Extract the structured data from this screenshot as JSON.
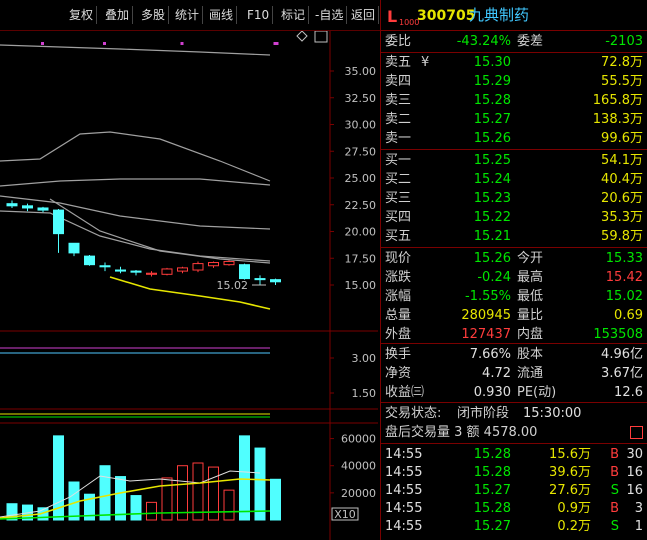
{
  "toolbar": {
    "items": [
      "复权",
      "叠加",
      "多股",
      "统计",
      "画线",
      "F10",
      "标记",
      "-自选",
      "返回"
    ]
  },
  "stock": {
    "badge": "L",
    "level": "1000",
    "code": "300705",
    "name": "九典制药"
  },
  "weibi": {
    "label1": "委比",
    "value1": "-43.24%",
    "label2": "委差",
    "value2": "-2103"
  },
  "sell": [
    {
      "label": "卖五",
      "mark": "¥",
      "price": "15.30",
      "vol": "72.8万"
    },
    {
      "label": "卖四",
      "mark": "",
      "price": "15.29",
      "vol": "55.5万"
    },
    {
      "label": "卖三",
      "mark": "",
      "price": "15.28",
      "vol": "165.8万"
    },
    {
      "label": "卖二",
      "mark": "",
      "price": "15.27",
      "vol": "138.3万"
    },
    {
      "label": "卖一",
      "mark": "",
      "price": "15.26",
      "vol": "99.6万"
    }
  ],
  "buy": [
    {
      "label": "买一",
      "price": "15.25",
      "vol": "54.1万"
    },
    {
      "label": "买二",
      "price": "15.24",
      "vol": "40.4万"
    },
    {
      "label": "买三",
      "price": "15.23",
      "vol": "20.6万"
    },
    {
      "label": "买四",
      "price": "15.22",
      "vol": "35.3万"
    },
    {
      "label": "买五",
      "price": "15.21",
      "vol": "59.8万"
    }
  ],
  "quote": [
    {
      "l1": "现价",
      "v1": "15.26",
      "l2": "今开",
      "v2": "15.33"
    },
    {
      "l1": "涨跌",
      "v1": "-0.24",
      "l2": "最高",
      "v2": "15.42"
    },
    {
      "l1": "涨幅",
      "v1": "-1.55%",
      "l2": "最低",
      "v2": "15.02"
    },
    {
      "l1": "总量",
      "v1": "280945",
      "l2": "量比",
      "v2": "0.69"
    },
    {
      "l1": "外盘",
      "v1": "127437",
      "l2": "内盘",
      "v2": "153508"
    }
  ],
  "stats": [
    {
      "l1": "换手",
      "v1": "7.66%",
      "l2": "股本",
      "v2": "4.96亿"
    },
    {
      "l1": "净资",
      "v1": "4.72",
      "l2": "流通",
      "v2": "3.67亿"
    },
    {
      "l1": "收益㈢",
      "v1": "0.930",
      "l2": "PE(动)",
      "v2": "12.6"
    }
  ],
  "trade_status": {
    "label": "交易状态:",
    "status": "闭市阶段",
    "time": "15:30:00"
  },
  "after_hours": {
    "text": "盘后交易量 3 额 4578.00"
  },
  "ticks": [
    {
      "time": "14:55",
      "price": "15.28",
      "vol": "15.6万",
      "side": "B",
      "n": "30"
    },
    {
      "time": "14:55",
      "price": "15.28",
      "vol": "39.6万",
      "side": "B",
      "n": "16"
    },
    {
      "time": "14:55",
      "price": "15.27",
      "vol": "27.6万",
      "side": "S",
      "n": "16"
    },
    {
      "time": "14:55",
      "price": "15.28",
      "vol": "0.9万",
      "side": "B",
      "n": "3"
    },
    {
      "time": "14:55",
      "price": "15.27",
      "vol": "0.2万",
      "side": "S",
      "n": "1"
    }
  ],
  "price_axis": [
    "35.00",
    "32.50",
    "30.00",
    "27.50",
    "25.00",
    "22.50",
    "20.00",
    "17.50",
    "15.00"
  ],
  "macd_axis": [
    "3.00",
    "1.50"
  ],
  "vol_axis": [
    "60000",
    "40000",
    "20000"
  ],
  "vol_unit": "X10",
  "low_label": "15.02",
  "candles": [
    {
      "o": 22.6,
      "c": 22.4,
      "h": 22.9,
      "l": 22.2
    },
    {
      "o": 22.4,
      "c": 22.2,
      "h": 22.6,
      "l": 21.9
    },
    {
      "o": 22.2,
      "c": 22.0,
      "h": 22.3,
      "l": 21.8
    },
    {
      "o": 22.0,
      "c": 19.8,
      "h": 22.1,
      "l": 18.0
    },
    {
      "o": 18.9,
      "c": 18.0,
      "h": 18.9,
      "l": 17.7
    },
    {
      "o": 17.7,
      "c": 16.9,
      "h": 17.8,
      "l": 16.8
    },
    {
      "o": 16.8,
      "c": 16.7,
      "h": 17.1,
      "l": 16.3
    },
    {
      "o": 16.4,
      "c": 16.3,
      "h": 16.7,
      "l": 16.1
    },
    {
      "o": 16.3,
      "c": 16.2,
      "h": 16.4,
      "l": 15.9
    },
    {
      "o": 16.0,
      "c": 16.1,
      "h": 16.3,
      "l": 15.8
    },
    {
      "o": 16.0,
      "c": 16.5,
      "h": 16.6,
      "l": 15.9
    },
    {
      "o": 16.3,
      "c": 16.6,
      "h": 16.7,
      "l": 16.1
    },
    {
      "o": 16.4,
      "c": 17.0,
      "h": 17.2,
      "l": 16.2
    },
    {
      "o": 16.8,
      "c": 17.1,
      "h": 17.2,
      "l": 16.6
    },
    {
      "o": 16.9,
      "c": 17.2,
      "h": 17.3,
      "l": 16.8
    },
    {
      "o": 16.9,
      "c": 15.6,
      "h": 17.0,
      "l": 15.5
    },
    {
      "o": 15.6,
      "c": 15.5,
      "h": 15.9,
      "l": 15.0
    },
    {
      "o": 15.5,
      "c": 15.3,
      "h": 15.6,
      "l": 15.0
    }
  ],
  "volumes": [
    12000,
    11000,
    9000,
    62000,
    28000,
    19000,
    40000,
    32000,
    18000,
    13000,
    31000,
    40000,
    42000,
    39000,
    22000,
    62000,
    53000,
    30000
  ]
}
